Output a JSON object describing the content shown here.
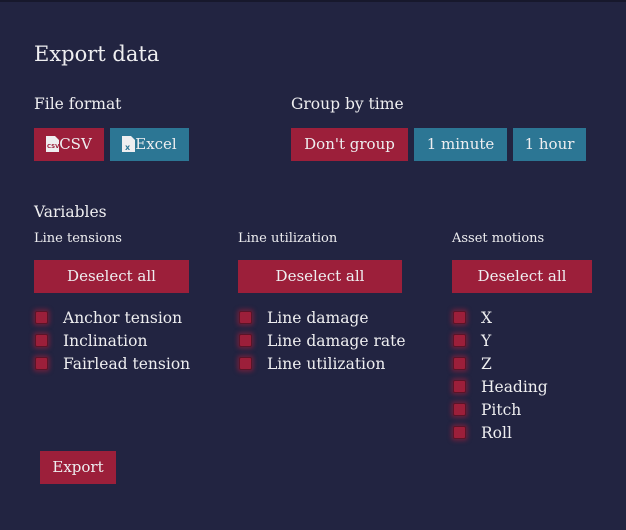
{
  "title": "Export data",
  "file_format": {
    "label": "File format",
    "options": [
      {
        "label": "CSV",
        "icon": "csv-file-icon",
        "selected": true
      },
      {
        "label": "Excel",
        "icon": "excel-file-icon",
        "selected": false
      }
    ]
  },
  "group_by_time": {
    "label": "Group by time",
    "options": [
      {
        "label": "Don't group",
        "selected": true
      },
      {
        "label": "1 minute",
        "selected": false
      },
      {
        "label": "1 hour",
        "selected": false
      }
    ]
  },
  "variables": {
    "label": "Variables",
    "groups": [
      {
        "label": "Line tensions",
        "deselect_label": "Deselect all",
        "items": [
          {
            "label": "Anchor tension",
            "checked": true
          },
          {
            "label": "Inclination",
            "checked": true
          },
          {
            "label": "Fairlead tension",
            "checked": true
          }
        ]
      },
      {
        "label": "Line utilization",
        "deselect_label": "Deselect all",
        "items": [
          {
            "label": "Line damage",
            "checked": true
          },
          {
            "label": "Line damage rate",
            "checked": true
          },
          {
            "label": "Line utilization",
            "checked": true
          }
        ]
      },
      {
        "label": "Asset motions",
        "deselect_label": "Deselect all",
        "items": [
          {
            "label": "X",
            "checked": true
          },
          {
            "label": "Y",
            "checked": true
          },
          {
            "label": "Z",
            "checked": true
          },
          {
            "label": "Heading",
            "checked": true
          },
          {
            "label": "Pitch",
            "checked": true
          },
          {
            "label": "Roll",
            "checked": true
          }
        ]
      }
    ]
  },
  "export_label": "Export",
  "colors": {
    "background": "#222441",
    "selected": "#9c1f3a",
    "unselected": "#2c7694",
    "text": "#eeeef0"
  }
}
